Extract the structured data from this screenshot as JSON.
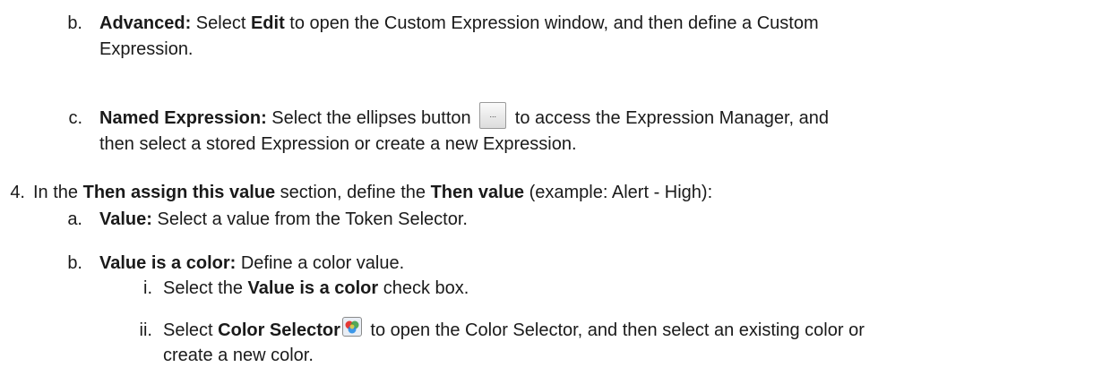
{
  "items": {
    "b_adv": {
      "marker": "b.",
      "term": "Advanced:",
      "t1": " Select ",
      "k1": "Edit",
      "t2": " to open the Custom Expression window, and then define a Custom",
      "cont": "Expression."
    },
    "c_named": {
      "marker": "c.",
      "term": "Named Expression:",
      "t1": " Select the ellipses button ",
      "button_icon": "ellipsis-button-icon",
      "button_glyph": "...",
      "t2": " to access the Expression Manager, and",
      "cont": "then select a stored Expression or create a new Expression."
    },
    "step4": {
      "marker": "4.",
      "t1": "In the ",
      "k1": "Then assign this value",
      "t2": " section, define the ",
      "k2": "Then value",
      "t3": " (example: Alert - High):"
    },
    "a_value": {
      "marker": "a.",
      "term": "Value:",
      "text": " Select a value from the Token Selector."
    },
    "b_color": {
      "marker": "b.",
      "term": "Value is a color:",
      "text": " Define a color value."
    },
    "i_check": {
      "marker": "i.",
      "t1": "Select the ",
      "k1": "Value is a color",
      "t2": " check box."
    },
    "ii_selector": {
      "marker": "ii.",
      "t1": "Select ",
      "k1": "Color Selector",
      "icon": "color-selector-icon",
      "t2": " to open the Color Selector, and then select an existing color or",
      "cont": "create a new color."
    }
  }
}
